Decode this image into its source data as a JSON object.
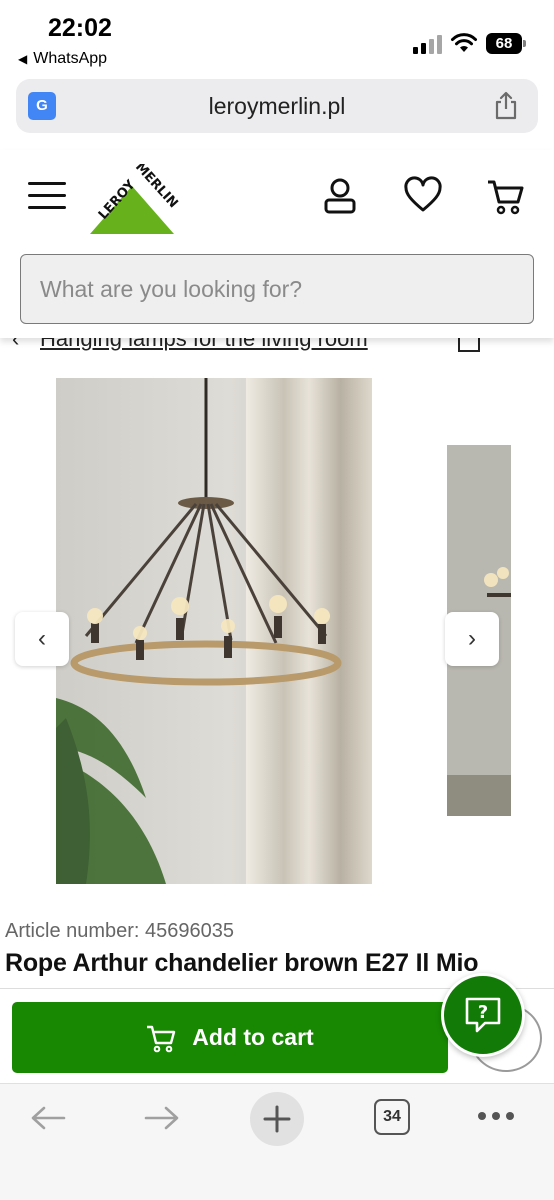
{
  "status_bar": {
    "time": "22:02",
    "back_app": "WhatsApp",
    "battery": "68"
  },
  "browser": {
    "url": "leroymerlin.pl",
    "translate_icon": "translate-icon",
    "share_icon": "share-icon"
  },
  "header": {
    "logo_text": "LEROY MERLIN",
    "icons": [
      "menu-icon",
      "account-icon",
      "wishlist-icon",
      "cart-icon"
    ],
    "search_placeholder": "What are you looking for?"
  },
  "breadcrumb": {
    "label": "Hanging lamps for the living room"
  },
  "gallery": {
    "prev_label": "‹",
    "next_label": "›"
  },
  "product": {
    "article_label": "Article number: 45696035",
    "title": "Rope Arthur chandelier brown E27 Il Mio"
  },
  "actions": {
    "add_to_cart": "Add to cart",
    "help_label": "?"
  },
  "toolbar": {
    "tabs_count": "34"
  },
  "colors": {
    "brand_green": "#188803",
    "logo_green": "#67b21c",
    "help_green": "#127a06"
  }
}
